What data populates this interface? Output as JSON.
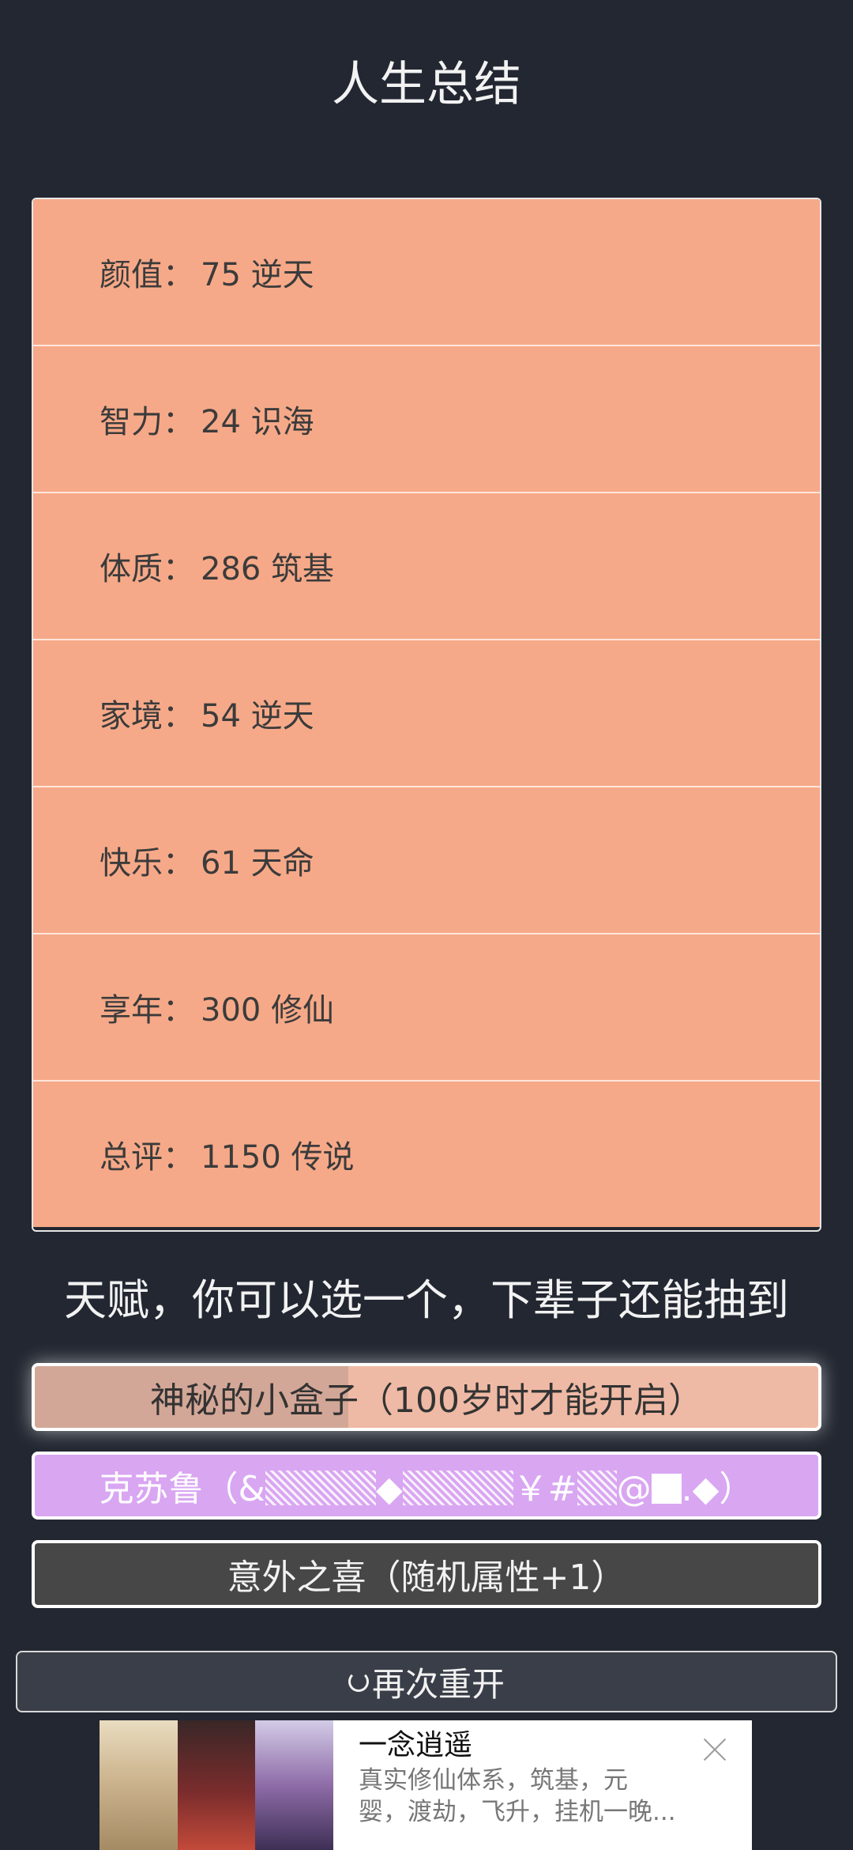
{
  "header": {
    "title": "人生总结"
  },
  "summary": {
    "separator": "：",
    "rows": [
      {
        "label": "颜值",
        "value": "75 逆天"
      },
      {
        "label": "智力",
        "value": "24 识海"
      },
      {
        "label": "体质",
        "value": "286 筑基"
      },
      {
        "label": "家境",
        "value": "54 逆天"
      },
      {
        "label": "快乐",
        "value": "61 天命"
      },
      {
        "label": "享年",
        "value": "300 修仙"
      },
      {
        "label": "总评",
        "value": "1150 传说"
      }
    ]
  },
  "talents": {
    "heading": "天赋，你可以选一个，下辈子还能抽到",
    "items": [
      {
        "label": "神秘的小盒子（100岁时才能开启）",
        "color": "#efbaa5",
        "selected": true
      },
      {
        "prefix": "克苏鲁（&",
        "mid1": "◆",
        "mid2": "￥#",
        "mid3": "@",
        "mid4": ".◆）",
        "color": "#d9a6f2"
      },
      {
        "label": "意外之喜（随机属性+1）",
        "color": "#474747"
      }
    ]
  },
  "restart": {
    "label": "再次重开",
    "icon": "refresh-icon"
  },
  "ad": {
    "title": "一念逍遥",
    "description": "真实修仙体系，筑基，元\n婴，渡劫，飞升，挂机一晚...",
    "close_icon": "close-icon"
  }
}
